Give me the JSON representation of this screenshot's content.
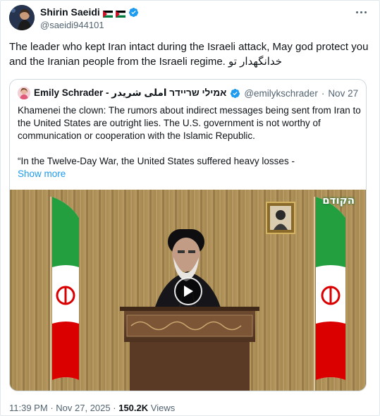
{
  "post": {
    "author_name": "Shirin Saeidi",
    "handle": "@saeidi944101",
    "text": "The leader who kept Iran intact during the Israeli attack, May god protect you and the Iranian people from the Israeli regime. خدانگهدار تو"
  },
  "quote": {
    "author_name": "Emily Schrader - אמילי שריידר املی شریدر",
    "handle": "@emilykschrader",
    "separator": "·",
    "date": "Nov 27",
    "paragraph1": "Khamenei the clown: The  rumors about indirect messages being sent from Iran to the United States are outright lies. The U.S. government is not worthy of communication or cooperation with the Islamic Republic.",
    "paragraph2": "“In the Twelve-Day War, the United States suffered heavy losses -",
    "show_more": "Show more",
    "media": {
      "watermark": "הקודם",
      "play_icon": "play-icon"
    }
  },
  "meta": {
    "time": "11:39 PM",
    "separator": "·",
    "date": "Nov 27, 2025",
    "views_count": "150.2K",
    "views_label": "Views"
  },
  "colors": {
    "accent": "#1d9bf0",
    "text_primary": "#0f1419",
    "text_secondary": "#536471",
    "border": "#cfd9de"
  }
}
